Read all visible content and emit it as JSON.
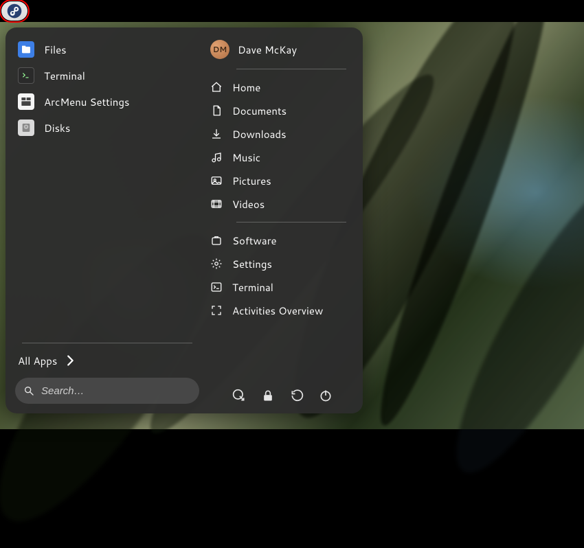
{
  "user": {
    "initials": "DM",
    "display_name": "Dave McKay"
  },
  "pinned": [
    {
      "name": "Files",
      "icon": "files-icon",
      "bg": "#3d7fe6"
    },
    {
      "name": "Terminal",
      "icon": "terminal-icon",
      "bg": "#2a2a2a"
    },
    {
      "name": "ArcMenu Settings",
      "icon": "arcmenu-icon",
      "bg": "#f5f5f5"
    },
    {
      "name": "Disks",
      "icon": "disks-icon",
      "bg": "#dadada"
    }
  ],
  "places_top": [
    {
      "name": "Home",
      "icon": "home-icon"
    },
    {
      "name": "Documents",
      "icon": "documents-icon"
    },
    {
      "name": "Downloads",
      "icon": "downloads-icon"
    },
    {
      "name": "Music",
      "icon": "music-icon"
    },
    {
      "name": "Pictures",
      "icon": "pictures-icon"
    },
    {
      "name": "Videos",
      "icon": "videos-icon"
    }
  ],
  "places_bottom": [
    {
      "name": "Software",
      "icon": "software-icon"
    },
    {
      "name": "Settings",
      "icon": "settings-icon"
    },
    {
      "name": "Terminal",
      "icon": "terminal-place-icon"
    },
    {
      "name": "Activities Overview",
      "icon": "activities-icon"
    }
  ],
  "session_buttons": [
    {
      "action": "logout",
      "icon": "logout-icon"
    },
    {
      "action": "lock",
      "icon": "lock-icon"
    },
    {
      "action": "restart",
      "icon": "restart-icon"
    },
    {
      "action": "poweroff",
      "icon": "poweroff-icon"
    }
  ],
  "all_apps_label": "All Apps",
  "search": {
    "placeholder": "Search…"
  }
}
